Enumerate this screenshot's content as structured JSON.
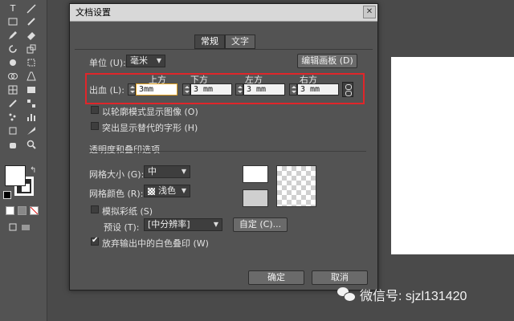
{
  "dialog": {
    "title": "文档设置",
    "tabs": [
      {
        "label": "常规"
      },
      {
        "label": "文字"
      }
    ],
    "units": {
      "label": "单位 (U):",
      "value": "毫米"
    },
    "edit_artboards_button": "编辑画板 (D)",
    "bleed": {
      "label": "出血 (L):",
      "fields": [
        {
          "heading": "上方",
          "value": "3mm"
        },
        {
          "heading": "下方",
          "value": "3 mm"
        },
        {
          "heading": "左方",
          "value": "3 mm"
        },
        {
          "heading": "右方",
          "value": "3 mm"
        }
      ]
    },
    "checkbox_outline": "以轮廓模式显示图像 (O)",
    "checkbox_glyphs": "突出显示替代的字形 (H)",
    "section_title": "透明度和叠印选项",
    "grid_size": {
      "label": "网格大小 (G):",
      "value": "中"
    },
    "grid_color": {
      "label": "网格颜色 (R):",
      "value": "浅色"
    },
    "simulate_paper": "模拟彩纸 (S)",
    "preset": {
      "label": "预设 (T):",
      "value": "[中分辨率]",
      "custom_button": "自定 (C)..."
    },
    "discard_white_overprint": "放弃输出中的白色叠印 (W)",
    "ok_button": "确定",
    "cancel_button": "取消"
  },
  "watermark": {
    "text": "微信号: sjzl131420"
  },
  "colors": {
    "highlight": "#e0262a",
    "dialog_bg": "#535353",
    "app_bg": "#4a4a4a"
  }
}
